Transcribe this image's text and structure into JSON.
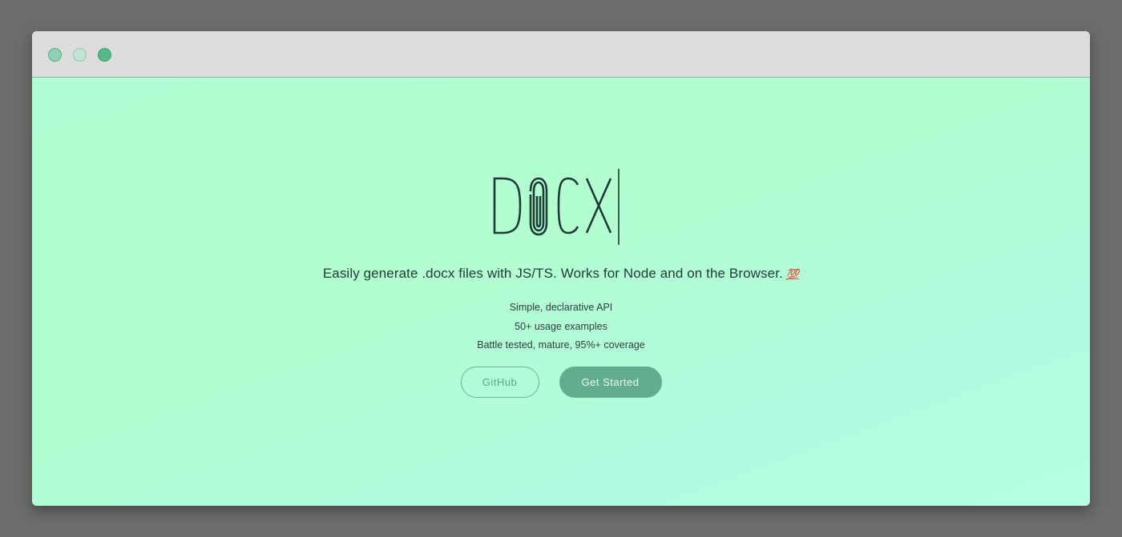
{
  "window": {
    "controls": [
      "close",
      "minimize",
      "maximize"
    ]
  },
  "hero": {
    "logo_text": "DOCX",
    "tagline": "Easily generate .docx files with JS/TS. Works for Node and on the Browser.",
    "tagline_emoji": "💯",
    "features": [
      "Simple, declarative API",
      "50+ usage examples",
      "Battle tested, mature, 95%+ coverage"
    ]
  },
  "buttons": {
    "github_label": "GitHub",
    "get_started_label": "Get Started"
  },
  "colors": {
    "background": "#b3fecf",
    "accent": "#62ad8d",
    "text": "#1f3b37"
  }
}
